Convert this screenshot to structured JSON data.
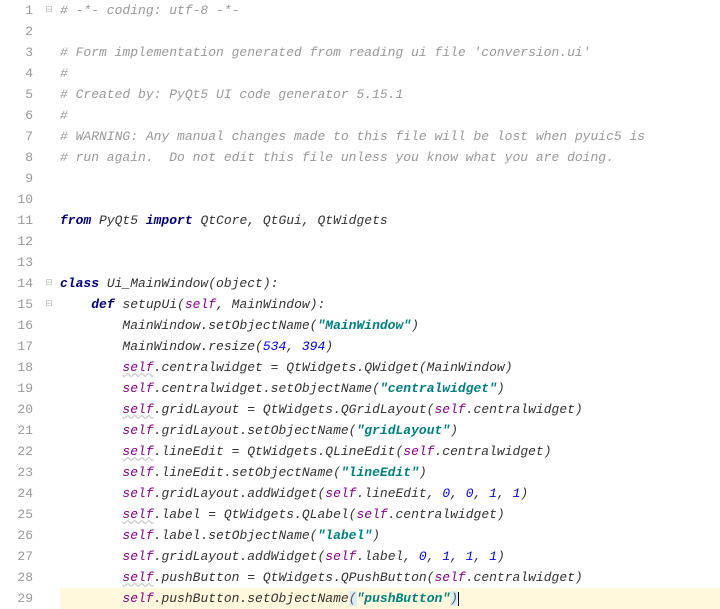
{
  "lines": [
    {
      "n": 1,
      "fold": true,
      "tokens": [
        {
          "t": "# -*- coding: utf-8 -*-",
          "c": "cm"
        }
      ]
    },
    {
      "n": 2,
      "tokens": []
    },
    {
      "n": 3,
      "tokens": [
        {
          "t": "# Form implementation generated from reading ui file 'conversion.ui'",
          "c": "cm"
        }
      ]
    },
    {
      "n": 4,
      "tokens": [
        {
          "t": "#",
          "c": "cm"
        }
      ]
    },
    {
      "n": 5,
      "tokens": [
        {
          "t": "# Created by: PyQt5 UI code generator 5.15.1",
          "c": "cm"
        }
      ]
    },
    {
      "n": 6,
      "tokens": [
        {
          "t": "#",
          "c": "cm"
        }
      ]
    },
    {
      "n": 7,
      "tokens": [
        {
          "t": "# WARNING: Any manual changes made to this file will be lost when pyuic5 is",
          "c": "cm"
        }
      ]
    },
    {
      "n": 8,
      "tokens": [
        {
          "t": "# run again.  Do not edit this file unless you know what you are doing.",
          "c": "cm"
        }
      ]
    },
    {
      "n": 9,
      "tokens": []
    },
    {
      "n": 10,
      "tokens": []
    },
    {
      "n": 11,
      "tokens": [
        {
          "t": "from ",
          "c": "kw"
        },
        {
          "t": "PyQt5 ",
          "c": "id"
        },
        {
          "t": "import ",
          "c": "kw"
        },
        {
          "t": "QtCore, QtGui, QtWidgets",
          "c": "id"
        }
      ]
    },
    {
      "n": 12,
      "tokens": []
    },
    {
      "n": 13,
      "tokens": []
    },
    {
      "n": 14,
      "fold": true,
      "tokens": [
        {
          "t": "class ",
          "c": "kw"
        },
        {
          "t": "Ui_MainWindow(",
          "c": "id"
        },
        {
          "t": "object",
          "c": "id"
        },
        {
          "t": "):",
          "c": "id"
        }
      ]
    },
    {
      "n": 15,
      "fold": true,
      "indent": 1,
      "tokens": [
        {
          "t": "def ",
          "c": "kw"
        },
        {
          "t": "setupUi(",
          "c": "id"
        },
        {
          "t": "self",
          "c": "self"
        },
        {
          "t": ", MainWindow):",
          "c": "id"
        }
      ]
    },
    {
      "n": 16,
      "indent": 2,
      "tokens": [
        {
          "t": "MainWindow.setObjectName(",
          "c": "id"
        },
        {
          "t": "\"MainWindow\"",
          "c": "str"
        },
        {
          "t": ")",
          "c": "id"
        }
      ]
    },
    {
      "n": 17,
      "indent": 2,
      "tokens": [
        {
          "t": "MainWindow.resize(",
          "c": "id"
        },
        {
          "t": "534",
          "c": "num"
        },
        {
          "t": ", ",
          "c": "id"
        },
        {
          "t": "394",
          "c": "num"
        },
        {
          "t": ")",
          "c": "id"
        }
      ]
    },
    {
      "n": 18,
      "indent": 2,
      "tokens": [
        {
          "t": "self",
          "c": "selfw"
        },
        {
          "t": ".centralwidget = QtWidgets.QWidget(MainWindow)",
          "c": "id"
        }
      ]
    },
    {
      "n": 19,
      "indent": 2,
      "tokens": [
        {
          "t": "self",
          "c": "self"
        },
        {
          "t": ".centralwidget.setObjectName(",
          "c": "id"
        },
        {
          "t": "\"centralwidget\"",
          "c": "str"
        },
        {
          "t": ")",
          "c": "id"
        }
      ]
    },
    {
      "n": 20,
      "indent": 2,
      "tokens": [
        {
          "t": "self",
          "c": "selfw"
        },
        {
          "t": ".gridLayout = QtWidgets.QGridLayout(",
          "c": "id"
        },
        {
          "t": "self",
          "c": "self"
        },
        {
          "t": ".centralwidget)",
          "c": "id"
        }
      ]
    },
    {
      "n": 21,
      "indent": 2,
      "tokens": [
        {
          "t": "self",
          "c": "self"
        },
        {
          "t": ".gridLayout.setObjectName(",
          "c": "id"
        },
        {
          "t": "\"gridLayout\"",
          "c": "str"
        },
        {
          "t": ")",
          "c": "id"
        }
      ]
    },
    {
      "n": 22,
      "indent": 2,
      "tokens": [
        {
          "t": "self",
          "c": "selfw"
        },
        {
          "t": ".lineEdit = QtWidgets.QLineEdit(",
          "c": "id"
        },
        {
          "t": "self",
          "c": "self"
        },
        {
          "t": ".centralwidget)",
          "c": "id"
        }
      ]
    },
    {
      "n": 23,
      "indent": 2,
      "tokens": [
        {
          "t": "self",
          "c": "self"
        },
        {
          "t": ".lineEdit.setObjectName(",
          "c": "id"
        },
        {
          "t": "\"lineEdit\"",
          "c": "str"
        },
        {
          "t": ")",
          "c": "id"
        }
      ]
    },
    {
      "n": 24,
      "indent": 2,
      "tokens": [
        {
          "t": "self",
          "c": "self"
        },
        {
          "t": ".gridLayout.addWidget(",
          "c": "id"
        },
        {
          "t": "self",
          "c": "self"
        },
        {
          "t": ".lineEdit, ",
          "c": "id"
        },
        {
          "t": "0",
          "c": "num"
        },
        {
          "t": ", ",
          "c": "id"
        },
        {
          "t": "0",
          "c": "num"
        },
        {
          "t": ", ",
          "c": "id"
        },
        {
          "t": "1",
          "c": "num"
        },
        {
          "t": ", ",
          "c": "id"
        },
        {
          "t": "1",
          "c": "num"
        },
        {
          "t": ")",
          "c": "id"
        }
      ]
    },
    {
      "n": 25,
      "indent": 2,
      "tokens": [
        {
          "t": "self",
          "c": "selfw"
        },
        {
          "t": ".label = QtWidgets.QLabel(",
          "c": "id"
        },
        {
          "t": "self",
          "c": "self"
        },
        {
          "t": ".centralwidget)",
          "c": "id"
        }
      ]
    },
    {
      "n": 26,
      "indent": 2,
      "tokens": [
        {
          "t": "self",
          "c": "self"
        },
        {
          "t": ".label.setObjectName(",
          "c": "id"
        },
        {
          "t": "\"label\"",
          "c": "str"
        },
        {
          "t": ")",
          "c": "id"
        }
      ]
    },
    {
      "n": 27,
      "indent": 2,
      "tokens": [
        {
          "t": "self",
          "c": "self"
        },
        {
          "t": ".gridLayout.addWidget(",
          "c": "id"
        },
        {
          "t": "self",
          "c": "self"
        },
        {
          "t": ".label, ",
          "c": "id"
        },
        {
          "t": "0",
          "c": "num"
        },
        {
          "t": ", ",
          "c": "id"
        },
        {
          "t": "1",
          "c": "num"
        },
        {
          "t": ", ",
          "c": "id"
        },
        {
          "t": "1",
          "c": "num"
        },
        {
          "t": ", ",
          "c": "id"
        },
        {
          "t": "1",
          "c": "num"
        },
        {
          "t": ")",
          "c": "id"
        }
      ]
    },
    {
      "n": 28,
      "indent": 2,
      "tokens": [
        {
          "t": "self",
          "c": "selfw"
        },
        {
          "t": ".pushButton = QtWidgets.QPushButton(",
          "c": "id"
        },
        {
          "t": "self",
          "c": "self"
        },
        {
          "t": ".centralwidget)",
          "c": "id"
        }
      ]
    },
    {
      "n": 29,
      "indent": 2,
      "hl": true,
      "tokens": [
        {
          "t": "self",
          "c": "self"
        },
        {
          "t": ".pushButton.setObjectName",
          "c": "id"
        },
        {
          "t": "(",
          "c": "br-hl"
        },
        {
          "t": "\"pushButton\"",
          "c": "str"
        },
        {
          "t": ")",
          "c": "br-hl"
        },
        {
          "caret": true
        }
      ]
    }
  ]
}
